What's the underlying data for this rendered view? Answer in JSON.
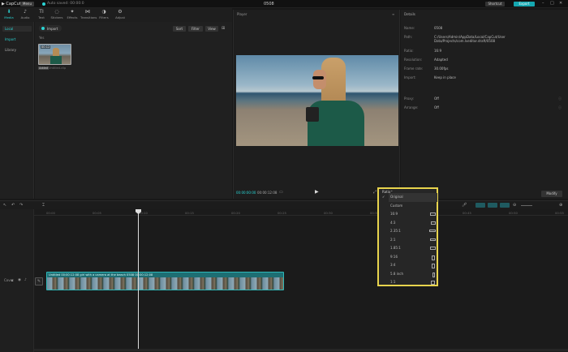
{
  "window": {
    "title": "0508",
    "menu_label": "Menu",
    "draft_label": "Auto saved: 00:00:0",
    "btn_shortcut": "Shortcut",
    "btn_export": "Export"
  },
  "toolbar": {
    "items": [
      {
        "icon": "media-icon",
        "glyph": "⬇",
        "label": "Media"
      },
      {
        "icon": "audio-icon",
        "glyph": "♪",
        "label": "Audio"
      },
      {
        "icon": "text-icon",
        "glyph": "TI",
        "label": "Text"
      },
      {
        "icon": "stickers-icon",
        "glyph": "◌",
        "label": "Stickers"
      },
      {
        "icon": "effects-icon",
        "glyph": "✦",
        "label": "Effects"
      },
      {
        "icon": "transitions-icon",
        "glyph": "⋈",
        "label": "Transitions"
      },
      {
        "icon": "filters-icon",
        "glyph": "◑",
        "label": "Filters"
      },
      {
        "icon": "adjustment-icon",
        "glyph": "⚙",
        "label": "Adjust"
      }
    ]
  },
  "sidenav": {
    "items": [
      "Local",
      "Import",
      "Library"
    ]
  },
  "media": {
    "import_label": "Import",
    "section": "Yes",
    "sort_label": "Sort",
    "filter_label": "Filter",
    "view_label": "View",
    "clip": {
      "duration": "00:12",
      "name": "Untitled-clip",
      "added": "Added"
    }
  },
  "player": {
    "title": "Player",
    "timecode": "00:00:00:00",
    "duration": "00:00:12:08",
    "ratio_label": "Ratio"
  },
  "details": {
    "title": "Details",
    "rows": [
      {
        "label": "Name:",
        "value": "0508"
      },
      {
        "label": "Path:",
        "value": "C:/Users/Admin/AppData/Local/CapCut/User Data/Projects/com.lveditor.draft/0508"
      },
      {
        "label": "Ratio:",
        "value": "16:9"
      },
      {
        "label": "Resolution:",
        "value": "Adapted"
      },
      {
        "label": "Frame rate:",
        "value": "30.00fps"
      },
      {
        "label": "Import:",
        "value": "Keep in place"
      },
      {
        "label": "Proxy:",
        "value": "Off"
      },
      {
        "label": "Arrange:",
        "value": "Off"
      }
    ],
    "modify_label": "Modify"
  },
  "timeline": {
    "ticks": [
      "00:00",
      "00:05",
      "00:10",
      "00:15",
      "00:20",
      "00:25",
      "00:30",
      "00:35",
      "00:40",
      "00:45",
      "00:50",
      "00:55"
    ],
    "clip_label": "Untitled 00:00:12:08  girl with a camera at the beach  0508  00:00:12:08"
  },
  "ratio_menu": {
    "header": "Ratio",
    "items": [
      {
        "label": "Original",
        "checked": true,
        "glyph": "none"
      },
      {
        "label": "Custom",
        "checked": false,
        "glyph": "none"
      },
      {
        "label": "16:9",
        "checked": false,
        "glyph": "wide"
      },
      {
        "label": "4:3",
        "checked": false,
        "glyph": "med"
      },
      {
        "label": "2.35:1",
        "checked": false,
        "glyph": "xwide"
      },
      {
        "label": "2:1",
        "checked": false,
        "glyph": "wide"
      },
      {
        "label": "1.85:1",
        "checked": false,
        "glyph": "wide"
      },
      {
        "label": "9:16",
        "checked": false,
        "glyph": "tall"
      },
      {
        "label": "3:4",
        "checked": false,
        "glyph": "med-tall"
      },
      {
        "label": "5.8 inch",
        "checked": false,
        "glyph": "tall"
      },
      {
        "label": "1:1",
        "checked": false,
        "glyph": "square"
      }
    ]
  },
  "colors": {
    "accent": "#2ad4d4",
    "highlight": "#e8d44d",
    "clip": "#1d6e73"
  }
}
